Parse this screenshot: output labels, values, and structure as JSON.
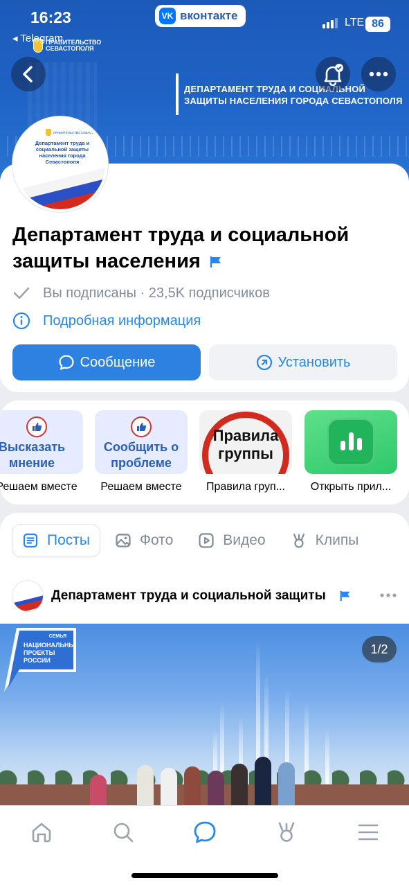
{
  "status_bar": {
    "time": "16:23",
    "back_app": "◂ Telegram",
    "vk_logo": "VK",
    "vk_label": "вконтакте",
    "network": "LTE",
    "battery": "86"
  },
  "cover": {
    "gov_logo_text": "ПРАВИТЕЛЬСТВО\nСЕВАСТОПОЛЯ",
    "department_text": "ДЕПАРТАМЕНТ ТРУДА И СОЦИАЛЬНОЙ\nЗАЩИТЫ НАСЕЛЕНИЯ ГОРОДА СЕВАСТОПОЛЯ"
  },
  "avatar": {
    "mini_label": "ПРАВИТЕЛЬСТВО СЕВАСТОПОЛЯ",
    "text": "Департамент труда и социальной защиты населения города Севастополя"
  },
  "group": {
    "title": "Департамент труда и социальной защиты населения",
    "subscription_status": "Вы подписаны · 23,5K подписчиков",
    "details_link": "Подробная информация",
    "message_button": "Сообщение",
    "install_button": "Установить"
  },
  "widgets": [
    {
      "title": "Высказать мнение",
      "caption": "Решаем вместе"
    },
    {
      "title": "Сообщить о проблеме",
      "caption": "Решаем вместе"
    },
    {
      "title": "Правила группы",
      "caption": "Правила груп..."
    },
    {
      "title": "",
      "caption": "Открыть прил..."
    }
  ],
  "tabs": [
    {
      "label": "Посты",
      "icon": "posts-icon",
      "active": true
    },
    {
      "label": "Фото",
      "icon": "photo-icon",
      "active": false
    },
    {
      "label": "Видео",
      "icon": "video-icon",
      "active": false
    },
    {
      "label": "Клипы",
      "icon": "clips-icon",
      "active": false
    }
  ],
  "post": {
    "author": "Департамент труда и социальной защиты",
    "photo_counter": "1/2",
    "badge_top": "СЕМЬЯ",
    "badge_main": "НАЦИОНАЛЬНЫЕ\nПРОЕКТЫ\nРОССИИ"
  },
  "bottom_nav": [
    {
      "icon": "home-icon"
    },
    {
      "icon": "search-icon"
    },
    {
      "icon": "messages-icon",
      "active": true
    },
    {
      "icon": "clips-icon"
    },
    {
      "icon": "menu-icon"
    }
  ],
  "colors": {
    "accent": "#2688eb",
    "primary_button": "#2d81e0",
    "cover": "#1f63c6",
    "secondary_text": "#818c99"
  }
}
